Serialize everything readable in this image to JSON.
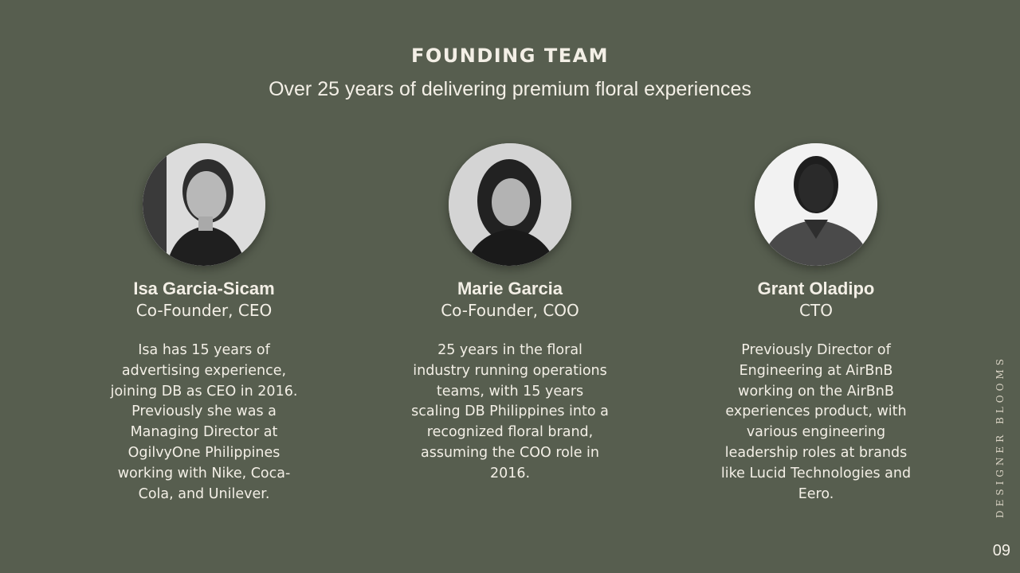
{
  "header": {
    "title": "FOUNDING TEAM",
    "subtitle": "Over 25 years of delivering premium floral experiences"
  },
  "team": [
    {
      "name": "Isa Garcia-Sicam",
      "role": "Co-Founder, CEO",
      "bio": "Isa has 15 years of advertising experience, joining DB as CEO in 2016. Previously she was a Managing Director at OgilvyOne Philippines working with Nike, Coca-Cola, and Unilever.",
      "photo_icon": "portrait-photo"
    },
    {
      "name": "Marie Garcia",
      "role": "Co-Founder, COO",
      "bio": "25 years in the floral industry running operations teams, with 15 years scaling DB Philippines into a recognized floral brand, assuming the COO role in 2016.",
      "photo_icon": "portrait-photo"
    },
    {
      "name": "Grant Oladipo",
      "role": "CTO",
      "bio": "Previously Director of Engineering at AirBnB working on the AirBnB experiences product, with various engineering leadership roles at brands like Lucid Technologies and Eero.",
      "photo_icon": "portrait-photo"
    }
  ],
  "footer": {
    "brand": "DESIGNER BLOOMS",
    "page_number": "09"
  },
  "colors": {
    "background": "#575e4f",
    "text": "#f3efe6"
  }
}
